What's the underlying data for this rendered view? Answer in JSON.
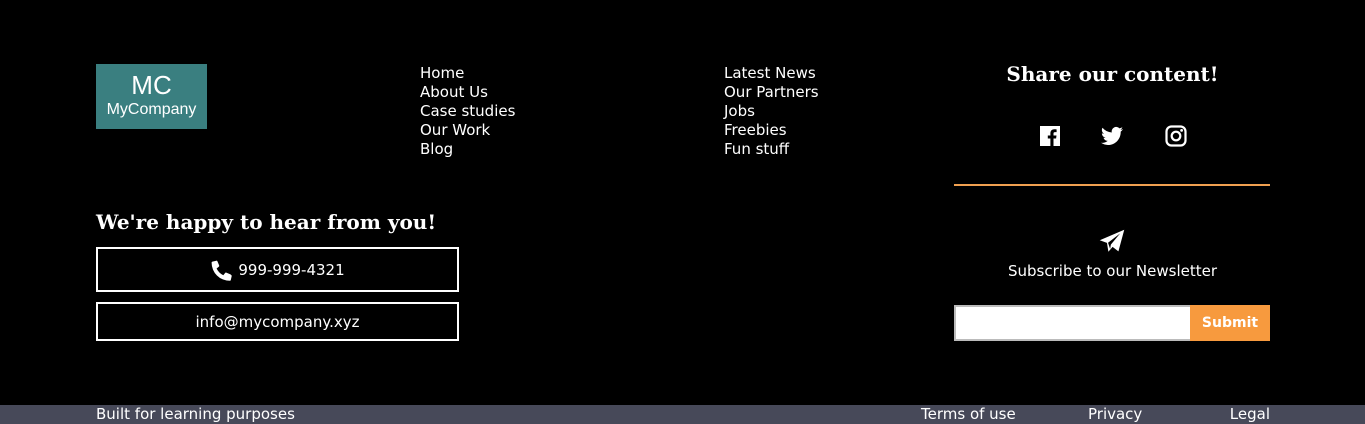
{
  "logo": {
    "initials": "MC",
    "name": "MyCompany",
    "bg_color": "#3a7f80"
  },
  "nav_primary": [
    {
      "label": "Home"
    },
    {
      "label": "About Us"
    },
    {
      "label": "Case studies"
    },
    {
      "label": "Our Work"
    },
    {
      "label": "Blog"
    }
  ],
  "nav_secondary": [
    {
      "label": "Latest News"
    },
    {
      "label": "Our Partners"
    },
    {
      "label": "Jobs"
    },
    {
      "label": "Freebies"
    },
    {
      "label": "Fun stuff"
    }
  ],
  "share": {
    "title": "Share our content!",
    "icons": [
      "facebook-icon",
      "twitter-icon",
      "instagram-icon"
    ]
  },
  "contact": {
    "title": "We're happy to hear from you!",
    "phone": "999-999-4321",
    "email": "info@mycompany.xyz"
  },
  "newsletter": {
    "text": "Subscribe to our Newsletter",
    "input_value": "",
    "submit_label": "Submit",
    "accent_color": "#f79a3e"
  },
  "footer_bar": {
    "built_text": "Built for learning purposes",
    "links": [
      {
        "label": "Terms of use"
      },
      {
        "label": "Privacy"
      },
      {
        "label": "Legal"
      }
    ],
    "bg_color": "#474959"
  }
}
